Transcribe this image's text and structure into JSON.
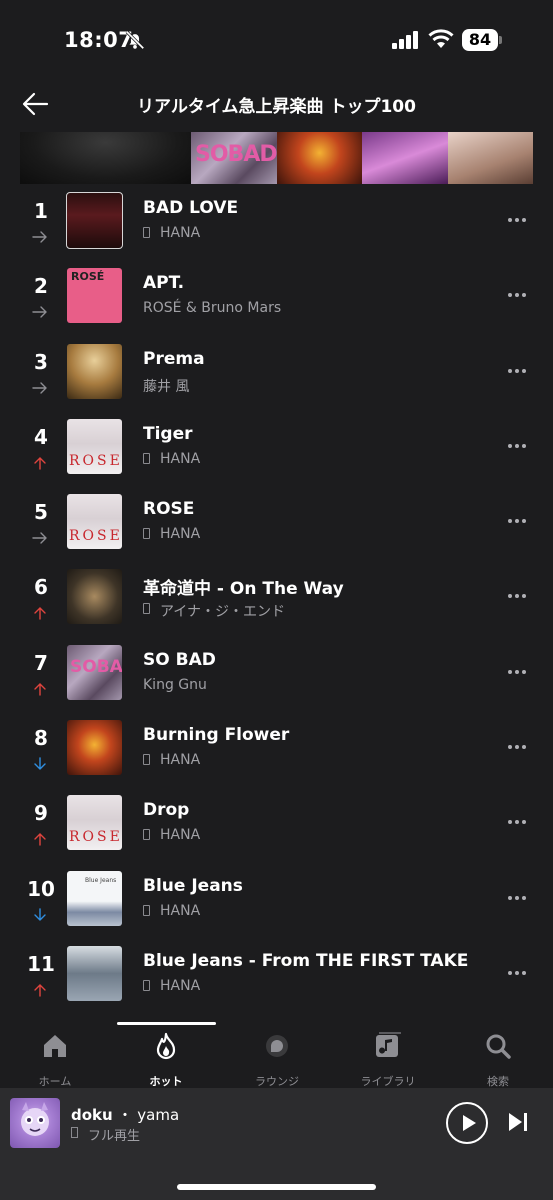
{
  "status": {
    "time": "18:07",
    "battery": "84"
  },
  "header": {
    "title": "リアルタイム急上昇楽曲 トップ100"
  },
  "banner": {
    "tile2_text": "SOBAD"
  },
  "songs": [
    {
      "rank": "1",
      "title": "BAD LOVE",
      "artist": "HANA",
      "badge": true,
      "trend": "same"
    },
    {
      "rank": "2",
      "title": "APT.",
      "artist": "ROSÉ & Bruno Mars",
      "badge": false,
      "trend": "same"
    },
    {
      "rank": "3",
      "title": "Prema",
      "artist": "藤井 風",
      "badge": false,
      "trend": "same"
    },
    {
      "rank": "4",
      "title": "Tiger",
      "artist": "HANA",
      "badge": true,
      "trend": "up"
    },
    {
      "rank": "5",
      "title": "ROSE",
      "artist": "HANA",
      "badge": true,
      "trend": "same"
    },
    {
      "rank": "6",
      "title": "革命道中 - On The Way",
      "artist": "アイナ・ジ・エンド",
      "badge": true,
      "trend": "up"
    },
    {
      "rank": "7",
      "title": "SO BAD",
      "artist": "King Gnu",
      "badge": false,
      "trend": "up"
    },
    {
      "rank": "8",
      "title": "Burning Flower",
      "artist": "HANA",
      "badge": true,
      "trend": "down"
    },
    {
      "rank": "9",
      "title": "Drop",
      "artist": "HANA",
      "badge": true,
      "trend": "up"
    },
    {
      "rank": "10",
      "title": "Blue Jeans",
      "artist": "HANA",
      "badge": true,
      "trend": "down"
    },
    {
      "rank": "11",
      "title": "Blue Jeans - From THE FIRST TAKE",
      "artist": "HANA",
      "badge": true,
      "trend": "up"
    }
  ],
  "art_text": {
    "apt": "ROSÉ",
    "rose": "ROSE",
    "sobad": "SOBAD",
    "bluejeans": "Blue Jeans"
  },
  "tabs": [
    {
      "label": "ホーム",
      "icon": "home-icon",
      "active": false
    },
    {
      "label": "ホット",
      "icon": "flame-icon",
      "active": true
    },
    {
      "label": "ラウンジ",
      "icon": "lounge-icon",
      "active": false
    },
    {
      "label": "ライブラリ",
      "icon": "music-library-icon",
      "active": false
    },
    {
      "label": "検索",
      "icon": "search-icon",
      "active": false
    }
  ],
  "now_playing": {
    "title": "doku",
    "separator": "・",
    "artist": "yama",
    "subtitle": "フル再生"
  },
  "colors": {
    "background": "#1c1c1e",
    "trend_up": "#e0443e",
    "trend_down": "#2f8ee0",
    "trend_same": "#8e8e93"
  }
}
